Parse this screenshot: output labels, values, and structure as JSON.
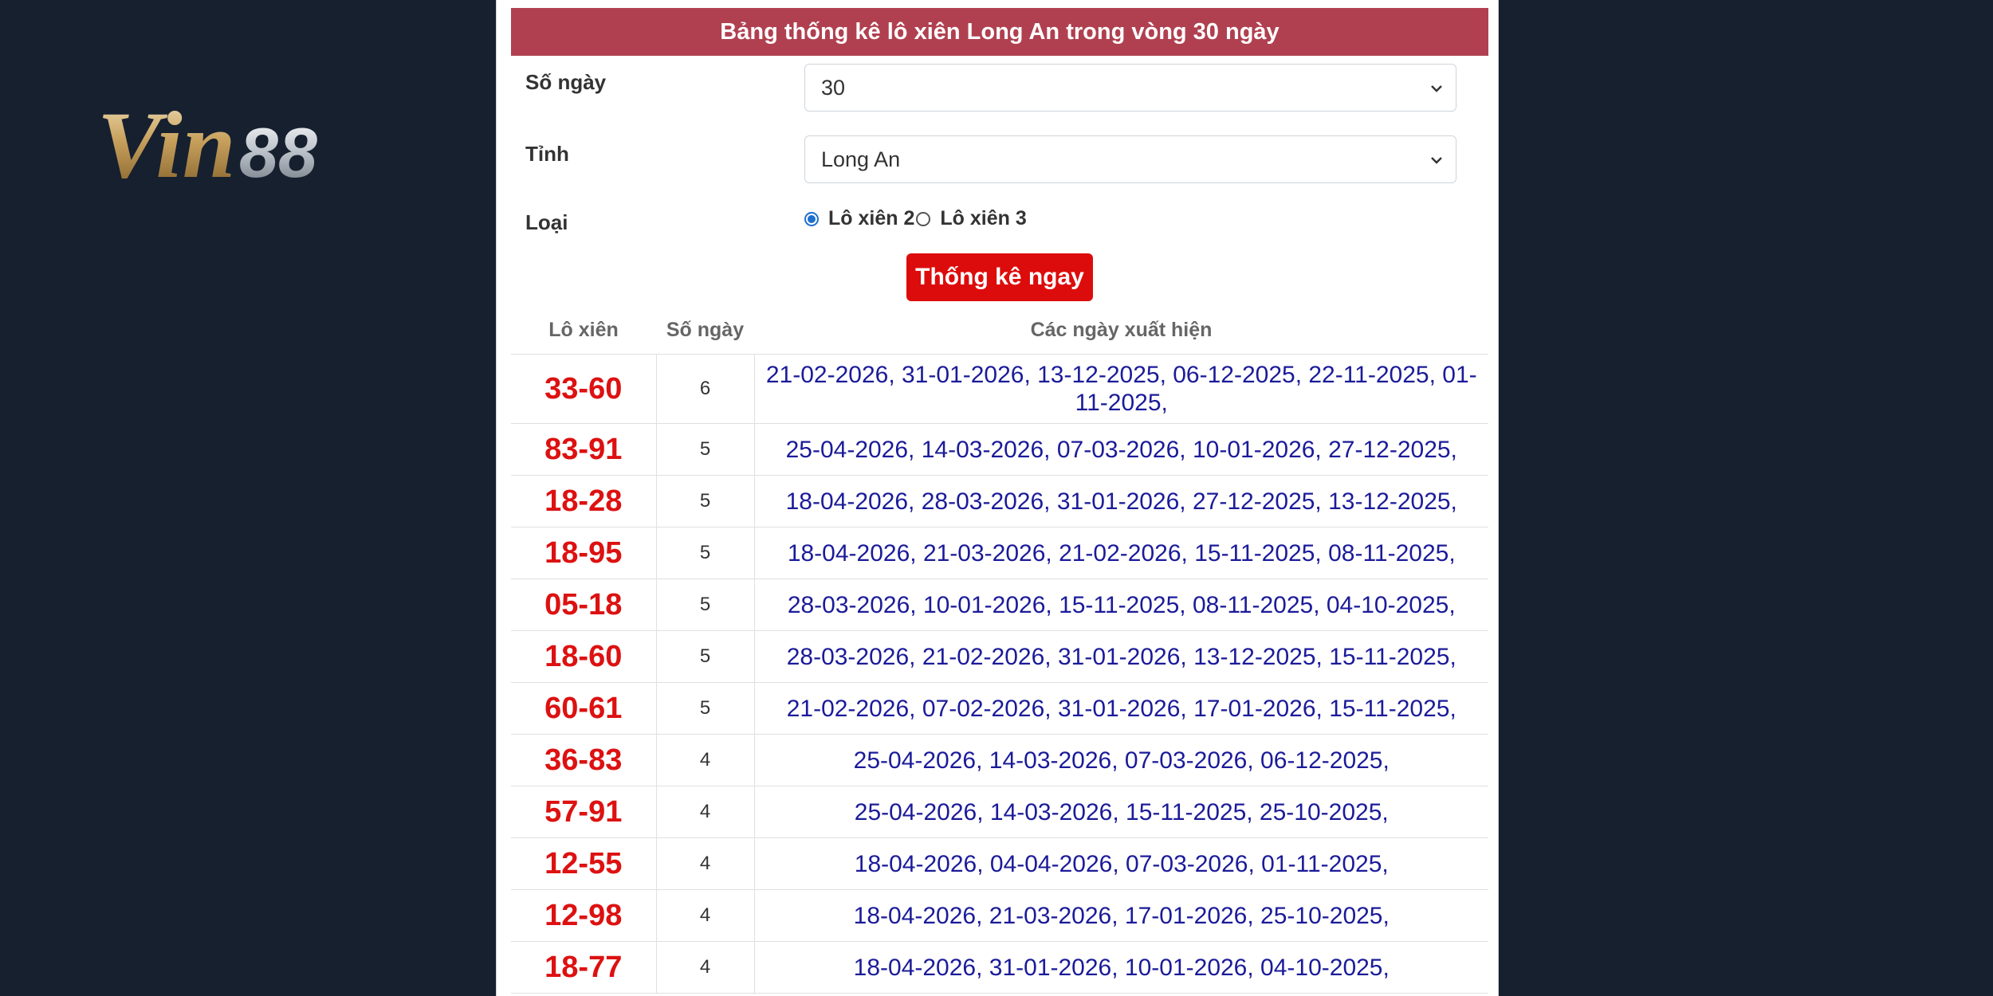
{
  "logo": {
    "text": "Vin88",
    "part1": "Vin",
    "part2": "88"
  },
  "page": {
    "title": "Bảng thống kê lô xiên Long An trong vòng 30 ngày"
  },
  "form": {
    "days_label": "Số ngày",
    "days_value": "30",
    "province_label": "Tỉnh",
    "province_value": "Long An",
    "type_label": "Loại",
    "type_option_1": "Lô xiên 2",
    "type_option_2": "Lô xiên 3",
    "submit_label": "Thống kê ngay"
  },
  "table": {
    "headers": [
      "Lô xiên",
      "Số ngày",
      "Các ngày xuất hiện"
    ],
    "rows": [
      {
        "pair": "33-60",
        "count": "6",
        "dates": "21-02-2026, 31-01-2026, 13-12-2025, 06-12-2025, 22-11-2025, 01-11-2025,"
      },
      {
        "pair": "83-91",
        "count": "5",
        "dates": "25-04-2026, 14-03-2026, 07-03-2026, 10-01-2026, 27-12-2025,"
      },
      {
        "pair": "18-28",
        "count": "5",
        "dates": "18-04-2026, 28-03-2026, 31-01-2026, 27-12-2025, 13-12-2025,"
      },
      {
        "pair": "18-95",
        "count": "5",
        "dates": "18-04-2026, 21-03-2026, 21-02-2026, 15-11-2025, 08-11-2025,"
      },
      {
        "pair": "05-18",
        "count": "5",
        "dates": "28-03-2026, 10-01-2026, 15-11-2025, 08-11-2025, 04-10-2025,"
      },
      {
        "pair": "18-60",
        "count": "5",
        "dates": "28-03-2026, 21-02-2026, 31-01-2026, 13-12-2025, 15-11-2025,"
      },
      {
        "pair": "60-61",
        "count": "5",
        "dates": "21-02-2026, 07-02-2026, 31-01-2026, 17-01-2026, 15-11-2025,"
      },
      {
        "pair": "36-83",
        "count": "4",
        "dates": "25-04-2026, 14-03-2026, 07-03-2026, 06-12-2025,"
      },
      {
        "pair": "57-91",
        "count": "4",
        "dates": "25-04-2026, 14-03-2026, 15-11-2025, 25-10-2025,"
      },
      {
        "pair": "12-55",
        "count": "4",
        "dates": "18-04-2026, 04-04-2026, 07-03-2026, 01-11-2025,"
      },
      {
        "pair": "12-98",
        "count": "4",
        "dates": "18-04-2026, 21-03-2026, 17-01-2026, 25-10-2025,"
      },
      {
        "pair": "18-77",
        "count": "4",
        "dates": "18-04-2026, 31-01-2026, 10-01-2026, 04-10-2025,"
      }
    ]
  },
  "icons": {
    "select_arrow": "chevron-down-icon"
  },
  "colors": {
    "title_bar": "#b04050",
    "button": "#dd0c0c",
    "pair_text": "#dd1111",
    "dates_text": "#1b1b99",
    "background": "#16202f"
  }
}
